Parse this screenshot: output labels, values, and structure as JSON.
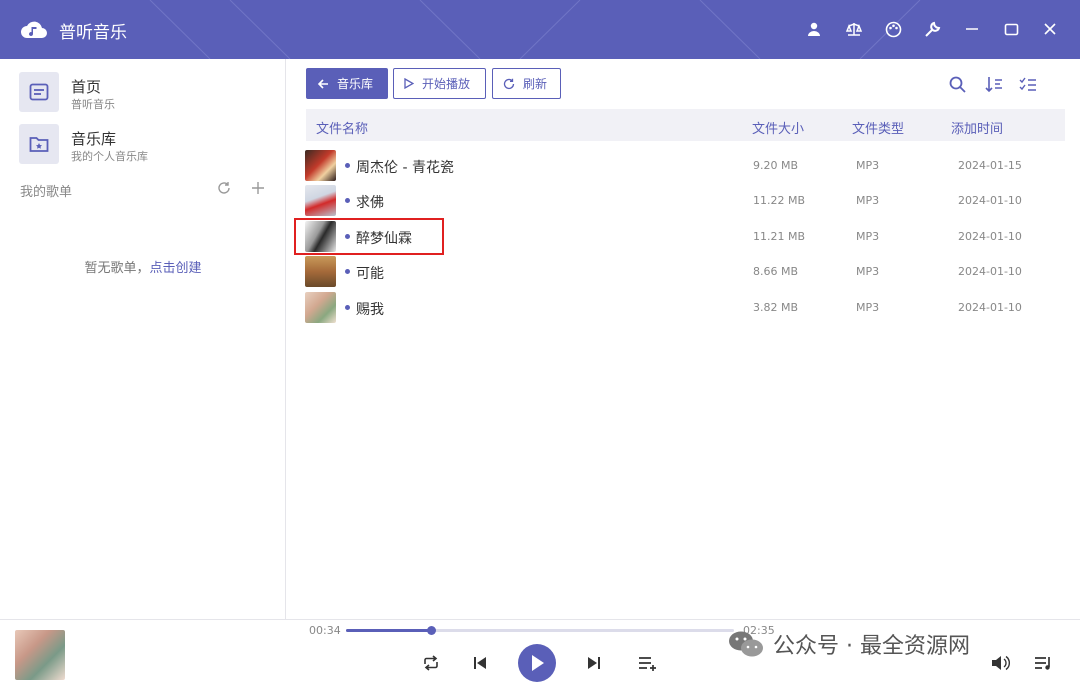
{
  "app": {
    "title": "普听音乐"
  },
  "colors": {
    "accent": "#5a5fb8",
    "highlight_box": "#e02020"
  },
  "titlebar": {
    "icons": [
      "user-icon",
      "scale-icon",
      "palette-icon",
      "wrench-icon",
      "minimize-icon",
      "maximize-icon",
      "close-icon"
    ]
  },
  "sidebar": {
    "items": [
      {
        "title": "首页",
        "subtitle": "普听音乐",
        "icon": "home-icon"
      },
      {
        "title": "音乐库",
        "subtitle": "我的个人音乐库",
        "icon": "folder-star-icon"
      }
    ],
    "playlists_title": "我的歌单",
    "empty_text": "暂无歌单，",
    "empty_link": "点击创建"
  },
  "toolbar": {
    "back_label": "音乐库",
    "play_label": "开始播放",
    "refresh_label": "刷新"
  },
  "table": {
    "headers": {
      "name": "文件名称",
      "size": "文件大小",
      "type": "文件类型",
      "added": "添加时间"
    },
    "rows": [
      {
        "name": "周杰伦 - 青花瓷",
        "size": "9.20 MB",
        "type": "MP3",
        "added": "2024-01-15"
      },
      {
        "name": "求佛",
        "size": "11.22 MB",
        "type": "MP3",
        "added": "2024-01-10"
      },
      {
        "name": "醉梦仙霖",
        "size": "11.21 MB",
        "type": "MP3",
        "added": "2024-01-10"
      },
      {
        "name": "可能",
        "size": "8.66 MB",
        "type": "MP3",
        "added": "2024-01-10"
      },
      {
        "name": "赐我",
        "size": "3.82 MB",
        "type": "MP3",
        "added": "2024-01-10"
      }
    ],
    "highlighted_row": 2
  },
  "player": {
    "current_time": "00:34",
    "total_time": "02:35",
    "progress": 0.22
  },
  "watermark": {
    "text": "公众号 · 最全资源网"
  }
}
